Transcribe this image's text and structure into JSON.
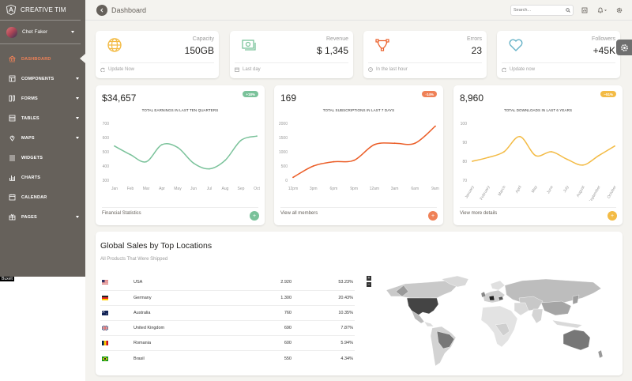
{
  "brand": {
    "name": "CREATIVE TIM"
  },
  "user": {
    "name": "Chet Faker"
  },
  "nav": [
    {
      "label": "DASHBOARD",
      "icon": "bank-icon",
      "caret": false,
      "active": true
    },
    {
      "label": "COMPONENTS",
      "icon": "layout-icon",
      "caret": true
    },
    {
      "label": "FORMS",
      "icon": "ruler-pencil-icon",
      "caret": true
    },
    {
      "label": "TABLES",
      "icon": "view-list-icon",
      "caret": true
    },
    {
      "label": "MAPS",
      "icon": "pin-icon",
      "caret": true
    },
    {
      "label": "WIDGETS",
      "icon": "widgets-icon",
      "caret": false
    },
    {
      "label": "CHARTS",
      "icon": "chart-bars-icon",
      "caret": false
    },
    {
      "label": "CALENDAR",
      "icon": "calendar-icon",
      "caret": false
    },
    {
      "label": "PAGES",
      "icon": "gift-icon",
      "caret": true
    }
  ],
  "sidebar_tag": "Buxelt",
  "topbar": {
    "title": "Dashboard",
    "search_placeholder": "Search..."
  },
  "stats": [
    {
      "label": "Capacity",
      "value": "150GB",
      "footer": "Update Now",
      "icon": "globe-icon",
      "color": "#f3bb45",
      "foot_icon": "refresh-icon"
    },
    {
      "label": "Revenue",
      "value": "$ 1,345",
      "footer": "Last day",
      "icon": "money-icon",
      "color": "#7ac29a",
      "foot_icon": "calendar-icon"
    },
    {
      "label": "Errors",
      "value": "23",
      "footer": "In the last hour",
      "icon": "vector-icon",
      "color": "#eb5e28",
      "foot_icon": "clock-icon"
    },
    {
      "label": "Followers",
      "value": "+45K",
      "footer": "Update now",
      "icon": "heart-icon",
      "color": "#68b3c8",
      "foot_icon": "refresh-icon"
    }
  ],
  "charts": [
    {
      "big": "$34,657",
      "badge": "+18%",
      "badge_color": "#7ac29a",
      "title": "TOTAL EARNINGS IN LAST TEN QUARTERS",
      "footer": "Financial Statistics",
      "button": "+",
      "button_color": "#7ac29a"
    },
    {
      "big": "169",
      "badge": "-14%",
      "badge_color": "#ef8157",
      "title": "TOTAL SUBSCRIPTIONS IN LAST 7 DAYS",
      "footer": "View all members",
      "button": "+",
      "button_color": "#ef8157"
    },
    {
      "big": "8,960",
      "badge": "~51%",
      "badge_color": "#f3bb45",
      "title": "TOTAL DOWNLOADS IN LAST 6 YEARS",
      "footer": "View more details",
      "button": "+",
      "button_color": "#f3bb45"
    }
  ],
  "chart_data": [
    {
      "type": "line",
      "title": "TOTAL EARNINGS IN LAST TEN QUARTERS",
      "categories": [
        "Jan",
        "Feb",
        "Mar",
        "Apr",
        "May",
        "Jun",
        "Jul",
        "Aug",
        "Sep",
        "Oct"
      ],
      "yticks": [
        "700",
        "600",
        "500",
        "400",
        "300"
      ],
      "ylim": [
        300,
        700
      ],
      "series": [
        {
          "values": [
            540,
            480,
            430,
            550,
            530,
            420,
            380,
            440,
            580,
            610
          ]
        }
      ],
      "color": "#7ac29a"
    },
    {
      "type": "line",
      "title": "TOTAL SUBSCRIPTIONS IN LAST 7 DAYS",
      "categories": [
        "12pm",
        "3pm",
        "6pm",
        "9pm",
        "12am",
        "3am",
        "6am",
        "9am"
      ],
      "yticks": [
        "2000",
        "1500",
        "1000",
        "500",
        "0"
      ],
      "ylim": [
        0,
        2000
      ],
      "series": [
        {
          "values": [
            100,
            500,
            650,
            700,
            1250,
            1300,
            1300,
            1900
          ]
        }
      ],
      "color": "#eb5e28"
    },
    {
      "type": "line",
      "title": "TOTAL DOWNLOADS IN LAST 6 YEARS",
      "categories": [
        "January",
        "February",
        "March",
        "April",
        "May",
        "June",
        "July",
        "August",
        "September",
        "October"
      ],
      "yticks": [
        "100",
        "90",
        "80",
        "70"
      ],
      "ylim": [
        70,
        100
      ],
      "series": [
        {
          "values": [
            80,
            82,
            85,
            93,
            83,
            85,
            81,
            78,
            83,
            88
          ]
        }
      ],
      "color": "#f3bb45"
    }
  ],
  "sales": {
    "title": "Global Sales by Top Locations",
    "subtitle": "All Products That Were Shipped",
    "rows": [
      {
        "flag": "us-flag-icon",
        "country": "USA",
        "count": "2.920",
        "pct": "53.23%"
      },
      {
        "flag": "de-flag-icon",
        "country": "Germany",
        "count": "1.300",
        "pct": "20.43%"
      },
      {
        "flag": "au-flag-icon",
        "country": "Australia",
        "count": "760",
        "pct": "10.35%"
      },
      {
        "flag": "gb-flag-icon",
        "country": "United Kingdom",
        "count": "690",
        "pct": "7.87%"
      },
      {
        "flag": "ro-flag-icon",
        "country": "Romania",
        "count": "600",
        "pct": "5.94%"
      },
      {
        "flag": "br-flag-icon",
        "country": "Brasil",
        "count": "550",
        "pct": "4.34%"
      }
    ],
    "zoom_in": "+",
    "zoom_out": "−"
  }
}
